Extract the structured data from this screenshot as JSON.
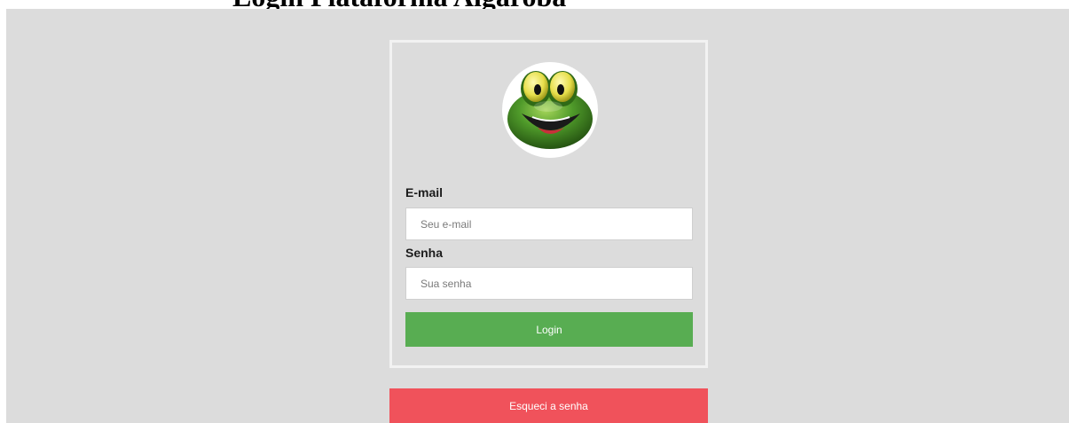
{
  "header": {
    "title": "Login Plataforma Algaroba"
  },
  "login_card": {
    "avatar_icon": "frog-avatar-icon",
    "email": {
      "label": "E-mail",
      "placeholder": "Seu e-mail",
      "value": ""
    },
    "password": {
      "label": "Senha",
      "placeholder": "Sua senha",
      "value": ""
    },
    "login_label": "Login"
  },
  "forgot_label": "Esqueci a senha",
  "colors": {
    "background": "#dcdcdc",
    "login_button": "#58ad52",
    "forgot_button": "#f0525b",
    "card_border": "#f2f2f2"
  }
}
